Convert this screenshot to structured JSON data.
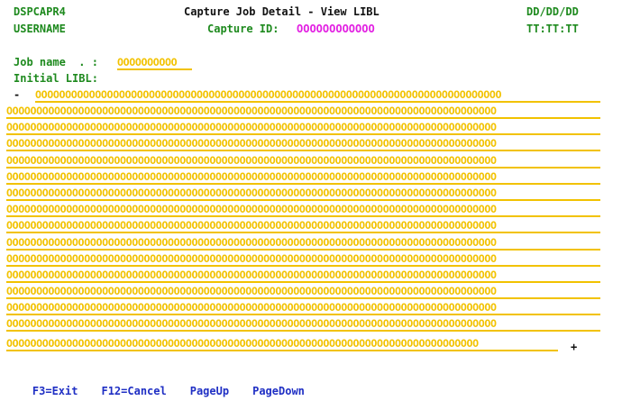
{
  "header": {
    "program": "DSPCAPR4",
    "title": "Capture Job Detail - View LIBL",
    "date": "DD/DD/DD",
    "user": "USERNAME",
    "capture_id_label": "Capture ID:",
    "capture_id_value": "OOOOOOOOOOOO",
    "time": "TT:TT:TT"
  },
  "form": {
    "job_name_label": "Job name  . :",
    "job_name_value": "OOOOOOOOOO",
    "initial_libl_label": "Initial LIBL:",
    "more_before": "-",
    "more_after": "+",
    "libl_lines": [
      "OOOOOOOOOOOOOOOOOOOOOOOOOOOOOOOOOOOOOOOOOOOOOOOOOOOOOOOOOOOOOOOOOOOOOOOOOOOOOO",
      "OOOOOOOOOOOOOOOOOOOOOOOOOOOOOOOOOOOOOOOOOOOOOOOOOOOOOOOOOOOOOOOOOOOOOOOOOOOOOOOOOO",
      "OOOOOOOOOOOOOOOOOOOOOOOOOOOOOOOOOOOOOOOOOOOOOOOOOOOOOOOOOOOOOOOOOOOOOOOOOOOOOOOOOO",
      "OOOOOOOOOOOOOOOOOOOOOOOOOOOOOOOOOOOOOOOOOOOOOOOOOOOOOOOOOOOOOOOOOOOOOOOOOOOOOOOOOO",
      "OOOOOOOOOOOOOOOOOOOOOOOOOOOOOOOOOOOOOOOOOOOOOOOOOOOOOOOOOOOOOOOOOOOOOOOOOOOOOOOOOO",
      "OOOOOOOOOOOOOOOOOOOOOOOOOOOOOOOOOOOOOOOOOOOOOOOOOOOOOOOOOOOOOOOOOOOOOOOOOOOOOOOOOO",
      "OOOOOOOOOOOOOOOOOOOOOOOOOOOOOOOOOOOOOOOOOOOOOOOOOOOOOOOOOOOOOOOOOOOOOOOOOOOOOOOOOO",
      "OOOOOOOOOOOOOOOOOOOOOOOOOOOOOOOOOOOOOOOOOOOOOOOOOOOOOOOOOOOOOOOOOOOOOOOOOOOOOOOOOO",
      "OOOOOOOOOOOOOOOOOOOOOOOOOOOOOOOOOOOOOOOOOOOOOOOOOOOOOOOOOOOOOOOOOOOOOOOOOOOOOOOOOO",
      "OOOOOOOOOOOOOOOOOOOOOOOOOOOOOOOOOOOOOOOOOOOOOOOOOOOOOOOOOOOOOOOOOOOOOOOOOOOOOOOOOO",
      "OOOOOOOOOOOOOOOOOOOOOOOOOOOOOOOOOOOOOOOOOOOOOOOOOOOOOOOOOOOOOOOOOOOOOOOOOOOOOOOOOO",
      "OOOOOOOOOOOOOOOOOOOOOOOOOOOOOOOOOOOOOOOOOOOOOOOOOOOOOOOOOOOOOOOOOOOOOOOOOOOOOOOOOO",
      "OOOOOOOOOOOOOOOOOOOOOOOOOOOOOOOOOOOOOOOOOOOOOOOOOOOOOOOOOOOOOOOOOOOOOOOOOOOOOOOOOO",
      "OOOOOOOOOOOOOOOOOOOOOOOOOOOOOOOOOOOOOOOOOOOOOOOOOOOOOOOOOOOOOOOOOOOOOOOOOOOOOOOOOO",
      "OOOOOOOOOOOOOOOOOOOOOOOOOOOOOOOOOOOOOOOOOOOOOOOOOOOOOOOOOOOOOOOOOOOOOOOOOOOOOOOOOO",
      "OOOOOOOOOOOOOOOOOOOOOOOOOOOOOOOOOOOOOOOOOOOOOOOOOOOOOOOOOOOOOOOOOOOOOOOOOOOOOOOOOO",
      "OOOOOOOOOOOOOOOOOOOOOOOOOOOOOOOOOOOOOOOOOOOOOOOOOOOOOOOOOOOOOOOOOOOOOOOOOOOOOOOOOO",
      "OOOOOOOOOOOOOOOOOOOOOOOOOOOOOOOOOOOOOOOOOOOOOOOOOOOOOOOOOOOOOOOOOOOOOOOOOOOOOOOOOO",
      "OOOOOOOOOOOOOOOOOOOOOOOOOOOOOOOOOOOOOOOOOOOOOOOOOOOOOOOOOOOOOOOOOOOOOOOOOOOOOOOOOO",
      "OOOOOOOOOOOOOOOOOOOOOOOOOOOOOOOOOOOOOOOOOOOOOOOOOOOOOOOOOOOOOOOOOOOOOOOOOOOOOOOOOO",
      "OOOOOOOOOOOOOOOOOOOOOOOOOOOOOOOOOOOOOOOOOOOOOOOOOOOOOOOOOOOOOOOOOOOOOOOOOOOOOOO"
    ]
  },
  "function_keys": {
    "f3": "F3=Exit",
    "f12": "F12=Cancel",
    "page_up": "PageUp",
    "page_down": "PageDown"
  },
  "colors": {
    "label": "#1e8a1e",
    "input": "#f2c200",
    "output_highlight": "#e21fe2",
    "function_key": "#1f2fc4"
  }
}
